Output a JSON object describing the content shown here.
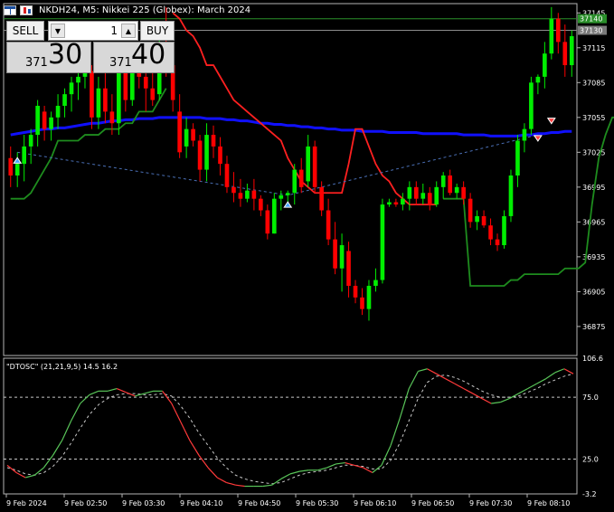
{
  "window": {
    "title": "NKDH24, M5:  Nikkei 225 (Globex): March 2024"
  },
  "trade_panel": {
    "sell_label": "SELL",
    "buy_label": "BUY",
    "volume": "1",
    "bid_prefix": "371",
    "bid_big": "30",
    "ask_prefix": "371",
    "ask_big": "40",
    "down_arrow": "▼",
    "up_arrow": "▲"
  },
  "colors": {
    "up_candle": "#00ee00",
    "down_candle": "#ff0000",
    "ma_line": "#1010ff",
    "trail_stop_red": "#ff2020",
    "trail_stop_green": "#1e8c1e",
    "price_line": "#2a8f2a",
    "osc_line_green": "#59c559",
    "osc_line_red": "#ff3a3a",
    "osc_signal": "#c8c8c8",
    "axis": "#b4b4b4"
  },
  "chart_data": [
    {
      "type": "candlestick",
      "y_axis_labels": [
        "37145",
        "37115",
        "37085",
        "37055",
        "37025",
        "36995",
        "36965",
        "36935",
        "36905",
        "36875"
      ],
      "ylim": [
        36850,
        37153
      ],
      "price_badges": [
        "37140",
        "37130"
      ],
      "x_labels": [
        "9 Feb 2024",
        "9 Feb 02:50",
        "9 Feb 03:30",
        "9 Feb 04:10",
        "9 Feb 04:50",
        "9 Feb 05:30",
        "9 Feb 06:10",
        "9 Feb 06:50",
        "9 Feb 07:30",
        "9 Feb 08:10"
      ],
      "candles": [
        [
          37020,
          37030,
          36995,
          37005
        ],
        [
          37005,
          37025,
          36995,
          37015
        ],
        [
          37015,
          37040,
          37000,
          37030
        ],
        [
          37030,
          37045,
          37015,
          37040
        ],
        [
          37040,
          37070,
          37030,
          37065
        ],
        [
          37060,
          37065,
          37035,
          37045
        ],
        [
          37045,
          37060,
          37035,
          37055
        ],
        [
          37055,
          37075,
          37045,
          37065
        ],
        [
          37065,
          37080,
          37055,
          37075
        ],
        [
          37075,
          37090,
          37060,
          37085
        ],
        [
          37085,
          37100,
          37070,
          37090
        ],
        [
          37090,
          37110,
          37080,
          37100
        ],
        [
          37095,
          37100,
          37045,
          37055
        ],
        [
          37055,
          37090,
          37045,
          37080
        ],
        [
          37080,
          37095,
          37050,
          37060
        ],
        [
          37060,
          37075,
          37040,
          37050
        ],
        [
          37050,
          37110,
          37040,
          37095
        ],
        [
          37095,
          37105,
          37060,
          37070
        ],
        [
          37070,
          37120,
          37065,
          37105
        ],
        [
          37105,
          37120,
          37080,
          37090
        ],
        [
          37090,
          37100,
          37060,
          37080
        ],
        [
          37080,
          37095,
          37065,
          37070
        ],
        [
          37075,
          37130,
          37070,
          37120
        ],
        [
          37120,
          37150,
          37090,
          37100
        ],
        [
          37100,
          37110,
          37060,
          37070
        ],
        [
          37060,
          37075,
          37020,
          37025
        ],
        [
          37030,
          37055,
          37020,
          37045
        ],
        [
          37045,
          37050,
          37030,
          37035
        ],
        [
          37035,
          37040,
          37000,
          37010
        ],
        [
          37010,
          37050,
          37000,
          37040
        ],
        [
          37040,
          37048,
          37020,
          37030
        ],
        [
          37030,
          37038,
          37005,
          37015
        ],
        [
          37015,
          37022,
          36990,
          36995
        ],
        [
          36995,
          37008,
          36982,
          36990
        ],
        [
          36990,
          37002,
          36978,
          36985
        ],
        [
          36985,
          36998,
          36982,
          36992
        ],
        [
          36992,
          37002,
          36975,
          36985
        ],
        [
          36985,
          36988,
          36970,
          36975
        ],
        [
          36975,
          36980,
          36950,
          36955
        ],
        [
          36955,
          36990,
          36955,
          36985
        ],
        [
          36985,
          36992,
          36975,
          36988
        ],
        [
          36988,
          36992,
          36980,
          36990
        ],
        [
          36990,
          37015,
          36980,
          37010
        ],
        [
          37010,
          37020,
          36990,
          36995
        ],
        [
          37000,
          37040,
          36995,
          37030
        ],
        [
          37030,
          37035,
          36990,
          36995
        ],
        [
          36995,
          37000,
          36970,
          36975
        ],
        [
          36975,
          36985,
          36945,
          36950
        ],
        [
          36950,
          36965,
          36920,
          36925
        ],
        [
          36925,
          36955,
          36905,
          36945
        ],
        [
          36940,
          36948,
          36900,
          36910
        ],
        [
          36910,
          36915,
          36895,
          36900
        ],
        [
          36900,
          36908,
          36885,
          36890
        ],
        [
          36890,
          36915,
          36880,
          36910
        ],
        [
          36910,
          36925,
          36905,
          36915
        ],
        [
          36915,
          36985,
          36912,
          36980
        ],
        [
          36980,
          36985,
          36978,
          36982
        ],
        [
          36982,
          36985,
          36978,
          36980
        ],
        [
          36980,
          36990,
          36975,
          36985
        ],
        [
          36985,
          37000,
          36975,
          36995
        ],
        [
          36995,
          37000,
          36980,
          36985
        ],
        [
          36985,
          36998,
          36980,
          36990
        ],
        [
          36990,
          36995,
          36975,
          36980
        ],
        [
          36980,
          37000,
          36978,
          36995
        ],
        [
          36995,
          37008,
          36985,
          37005
        ],
        [
          37005,
          37010,
          36988,
          36990
        ],
        [
          36990,
          36998,
          36985,
          36995
        ],
        [
          36995,
          37000,
          36980,
          36985
        ],
        [
          36985,
          36990,
          36960,
          36965
        ],
        [
          36965,
          36975,
          36958,
          36970
        ],
        [
          36970,
          36975,
          36960,
          36962
        ],
        [
          36962,
          36968,
          36945,
          36950
        ],
        [
          36950,
          36955,
          36940,
          36945
        ],
        [
          36945,
          36975,
          36942,
          36970
        ],
        [
          36970,
          37010,
          36965,
          37005
        ],
        [
          37005,
          37040,
          36995,
          37035
        ],
        [
          37035,
          37050,
          37025,
          37045
        ],
        [
          37045,
          37090,
          37040,
          37085
        ],
        [
          37085,
          37092,
          37075,
          37090
        ],
        [
          37090,
          37120,
          37080,
          37110
        ],
        [
          37110,
          37150,
          37105,
          37140
        ],
        [
          37140,
          37145,
          37110,
          37120
        ],
        [
          37120,
          37135,
          37090,
          37100
        ],
        [
          37100,
          37130,
          37090,
          37125
        ]
      ],
      "ma": [
        37040,
        37041,
        37042,
        37043,
        37044,
        37045,
        37045,
        37046,
        37046,
        37047,
        37048,
        37049,
        37050,
        37050,
        37051,
        37052,
        37052,
        37053,
        37053,
        37054,
        37054,
        37054,
        37055,
        37055,
        37055,
        37055,
        37055,
        37055,
        37055,
        37054,
        37054,
        37054,
        37053,
        37053,
        37052,
        37052,
        37051,
        37050,
        37050,
        37049,
        37049,
        37048,
        37048,
        37047,
        37047,
        37046,
        37046,
        37045,
        37045,
        37044,
        37044,
        37044,
        37043,
        37043,
        37043,
        37043,
        37042,
        37042,
        37042,
        37042,
        37042,
        37041,
        37041,
        37041,
        37041,
        37041,
        37041,
        37040,
        37040,
        37040,
        37040,
        37039,
        37039,
        37039,
        37039,
        37039,
        37040,
        37040,
        37041,
        37041,
        37042,
        37042,
        37043,
        37043
      ],
      "trail_stop": [
        {
          "color": "green",
          "values": [
            36985,
            36985,
            36985,
            36990,
            37000,
            37010,
            37020,
            37035,
            37035,
            37035,
            37035,
            37040,
            37040,
            37040,
            37045,
            37045,
            37045,
            37050,
            37050,
            37060,
            37060,
            37060,
            37070,
            37080
          ]
        },
        {
          "color": "red",
          "values": [
            37145,
            37140,
            37130,
            37125,
            37115,
            37100,
            37100,
            37090,
            37080,
            37070,
            37065,
            37060,
            37055,
            37050,
            37045,
            37040,
            37035,
            37020,
            37010,
            37000,
            36995,
            36990,
            36990,
            36990,
            36990,
            36990,
            37015,
            37045,
            37045,
            37030,
            37015,
            37005,
            37000,
            36990,
            36985,
            36980,
            36980,
            36980,
            36980,
            36980
          ]
        },
        {
          "color": "green",
          "values": [
            36985,
            36985,
            36985,
            36985,
            36910,
            36910,
            36910,
            36910,
            36910,
            36910,
            36915,
            36915,
            36920,
            36920,
            36920,
            36920,
            36920,
            36920,
            36925,
            36925,
            36925,
            36930,
            36980,
            37020,
            37040,
            37055,
            37055
          ]
        }
      ],
      "arrows": [
        {
          "dir": "up",
          "index": 1,
          "value": 37018
        },
        {
          "dir": "up",
          "index": 41,
          "value": 36980
        },
        {
          "dir": "down",
          "index": 78,
          "value": 37037
        },
        {
          "dir": "down",
          "index": 80,
          "value": 37052
        }
      ],
      "dashed_segments": [
        [
          [
            1,
            37025
          ],
          [
            41,
            36988
          ],
          [
            78,
            37040
          ]
        ]
      ]
    },
    {
      "type": "line",
      "title": "\"DTOSC\" (21,21,9,5) 14.5 16.2",
      "y_axis_labels": [
        "106.6",
        "75.0",
        "25.0",
        "-3.2"
      ],
      "ylim": [
        -3.2,
        106.6
      ],
      "levels": [
        75,
        25
      ],
      "series": [
        {
          "values": [
            20,
            14,
            10,
            12,
            18,
            28,
            40,
            56,
            70,
            77,
            80,
            80,
            82,
            79,
            76,
            78,
            80,
            80,
            70,
            55,
            40,
            28,
            18,
            10,
            6,
            4,
            3,
            3,
            3,
            4,
            9,
            13,
            15,
            16,
            16,
            18,
            21,
            22,
            20,
            18,
            14,
            20,
            36,
            58,
            82,
            96,
            98,
            94,
            90,
            86,
            82,
            78,
            74,
            70,
            71,
            74,
            78,
            82,
            86,
            90,
            95,
            98,
            94
          ]
        },
        {
          "values": [
            18,
            16,
            13,
            12,
            14,
            19,
            27,
            38,
            50,
            61,
            69,
            74,
            77,
            78,
            78,
            77,
            77,
            78,
            76,
            68,
            58,
            46,
            36,
            26,
            18,
            12,
            9,
            7,
            6,
            5,
            6,
            9,
            12,
            14,
            15,
            16,
            18,
            20,
            20,
            19,
            17,
            17,
            24,
            38,
            56,
            74,
            87,
            92,
            93,
            91,
            88,
            84,
            80,
            77,
            75,
            75,
            76,
            79,
            82,
            86,
            89,
            92,
            94
          ]
        }
      ]
    }
  ]
}
